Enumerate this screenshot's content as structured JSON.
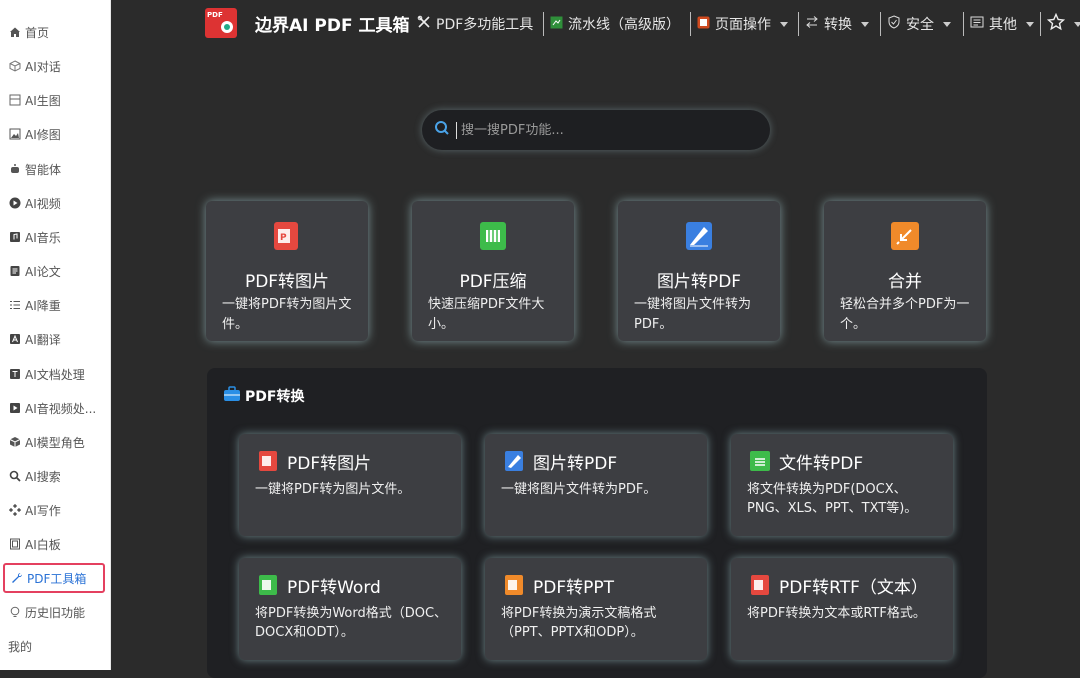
{
  "sidebar": {
    "items": [
      {
        "label": "首页",
        "icon": "home-icon"
      },
      {
        "label": "AI对话",
        "icon": "cube-icon"
      },
      {
        "label": "AI生图",
        "icon": "image-frame-icon"
      },
      {
        "label": "AI修图",
        "icon": "picture-icon"
      },
      {
        "label": "智能体",
        "icon": "robot-icon"
      },
      {
        "label": "AI视频",
        "icon": "play-circle-icon"
      },
      {
        "label": "AI音乐",
        "icon": "music-icon"
      },
      {
        "label": "AI论文",
        "icon": "document-icon"
      },
      {
        "label": "AI降重",
        "icon": "list-icon"
      },
      {
        "label": "AI翻译",
        "icon": "translate-icon"
      },
      {
        "label": "AI文档处理",
        "icon": "text-doc-icon"
      },
      {
        "label": "AI音视频处...",
        "icon": "media-icon"
      },
      {
        "label": "AI模型角色",
        "icon": "box-icon"
      },
      {
        "label": "AI搜索",
        "icon": "search-icon"
      },
      {
        "label": "AI写作",
        "icon": "pen-icon"
      },
      {
        "label": "AI白板",
        "icon": "whiteboard-icon"
      },
      {
        "label": "PDF工具箱",
        "icon": "wrench-icon"
      },
      {
        "label": "历史旧功能",
        "icon": "bulb-icon"
      },
      {
        "label": "我的",
        "icon": ""
      }
    ]
  },
  "header": {
    "brand": "边界AI PDF 工具箱",
    "logo_text": "PDF",
    "nav": [
      {
        "label": "PDF多功能工具",
        "icon": "tools-icon"
      },
      {
        "label": "流水线（高级版）",
        "icon": "pipeline-icon"
      },
      {
        "label": "页面操作",
        "icon": "pages-icon"
      },
      {
        "label": "转换",
        "icon": "swap-icon"
      },
      {
        "label": "安全",
        "icon": "shield-icon"
      },
      {
        "label": "其他",
        "icon": "menu-icon"
      }
    ]
  },
  "search": {
    "placeholder": "搜一搜PDF功能..."
  },
  "featured": [
    {
      "title": "PDF转图片",
      "desc": "一键将PDF转为图片文件。",
      "color": "#e5483f"
    },
    {
      "title": "PDF压缩",
      "desc": "快速压缩PDF文件大小。",
      "color": "#3dbb4a"
    },
    {
      "title": "图片转PDF",
      "desc": "一键将图片文件转为PDF。",
      "color": "#3a7fe0"
    },
    {
      "title": "合并",
      "desc": "轻松合并多个PDF为一个。",
      "color": "#f08a2a"
    }
  ],
  "section": {
    "title": "PDF转换",
    "tools": [
      {
        "title": "PDF转图片",
        "desc": "一键将PDF转为图片文件。",
        "color": "#e5483f"
      },
      {
        "title": "图片转PDF",
        "desc": "一键将图片文件转为PDF。",
        "color": "#3a7fe0"
      },
      {
        "title": "文件转PDF",
        "desc": "将文件转换为PDF(DOCX、PNG、XLS、PPT、TXT等)。",
        "color": "#3dbb4a"
      },
      {
        "title": "PDF转Word",
        "desc": "将PDF转换为Word格式（DOC、DOCX和ODT）。",
        "color": "#3dbb4a"
      },
      {
        "title": "PDF转PPT",
        "desc": "将PDF转换为演示文稿格式（PPT、PPTX和ODP）。",
        "color": "#f08a2a"
      },
      {
        "title": "PDF转RTF（文本）",
        "desc": "将PDF转换为文本或RTF格式。",
        "color": "#e5483f"
      }
    ]
  }
}
